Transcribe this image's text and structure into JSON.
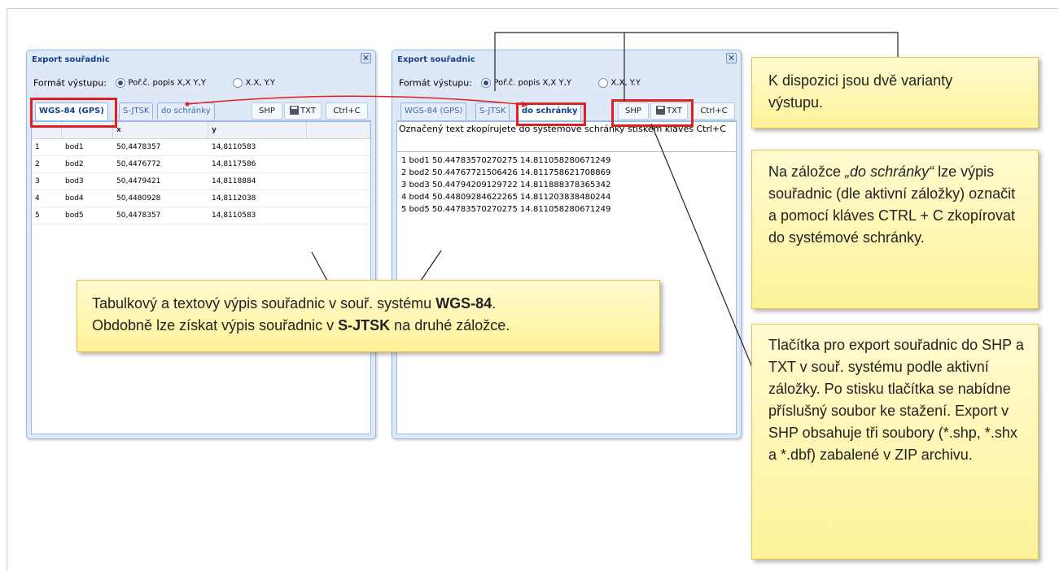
{
  "export_dialog": {
    "title": "Export souřadnic",
    "close_glyph": "✕",
    "format_label": "Formát výstupu:",
    "format_options": [
      "Poř.č. popis X,X Y,Y",
      "X.X, Y.Y"
    ],
    "tabs": [
      "WGS-84 (GPS)",
      "S-JTSK",
      "do schránky"
    ],
    "toolbar": {
      "shp": "SHP",
      "txt": "TXT",
      "copy": "Ctrl+C",
      "save_icon": "floppy-disk-icon"
    }
  },
  "coordinate_table": {
    "columns": [
      "",
      "",
      "x",
      "y"
    ],
    "rows": [
      {
        "n": "1",
        "name": "bod1",
        "x": "50,4478357",
        "y": "14,8110583"
      },
      {
        "n": "2",
        "name": "bod2",
        "x": "50,4476772",
        "y": "14,8117586"
      },
      {
        "n": "3",
        "name": "bod3",
        "x": "50,4479421",
        "y": "14,8118884"
      },
      {
        "n": "4",
        "name": "bod4",
        "x": "50,4480928",
        "y": "14,8112038"
      },
      {
        "n": "5",
        "name": "bod5",
        "x": "50,4478357",
        "y": "14,8110583"
      }
    ]
  },
  "clipboard_panel": {
    "note": "Označený text zkopírujete do systémové schránky stiskem kláves Ctrl+C",
    "lines": [
      "1 bod1 50.44783570270275 14.811058280671249",
      "2 bod2 50.44767721506426 14.811758621708869",
      "3 bod3 50.44794209129722 14.811888378365342",
      "4 bod4 50.44809284622265 14.811203838480244",
      "5 bod5 50.44783570270275 14.811058280671249"
    ]
  },
  "callouts": {
    "variants": "K dispozici jsou dvě varianty výstupu.",
    "clipboard": {
      "pre": "Na záložce ",
      "em": "„do schránky“",
      "post": " lze výpis souřadnic (dle aktivní záložky) označit a pomocí kláves CTRL + C zkopírovat do systémové schránky."
    },
    "table": {
      "line1_pre": "Tabulkový a textový výpis souřadnic v souř. systému ",
      "line1_bold": "WGS-84",
      "line1_post": ".",
      "line2_pre": "Obdobně lze získat výpis souřadnic v ",
      "line2_bold": "S-JTSK",
      "line2_post": " na druhé záložce."
    },
    "export_buttons": "Tlačítka pro export souřadnic do SHP a TXT v souř. systému podle aktivní záložky. Po stisku tlačítka se nabídne příslušný soubor ke stažení. Export v SHP obsahuje tři soubory (*.shp, *.shx a *.dbf) zabalené v ZIP archivu."
  },
  "colors": {
    "highlight": "#e02020",
    "callout_bg": "#fef29a",
    "title": "#15428b"
  }
}
